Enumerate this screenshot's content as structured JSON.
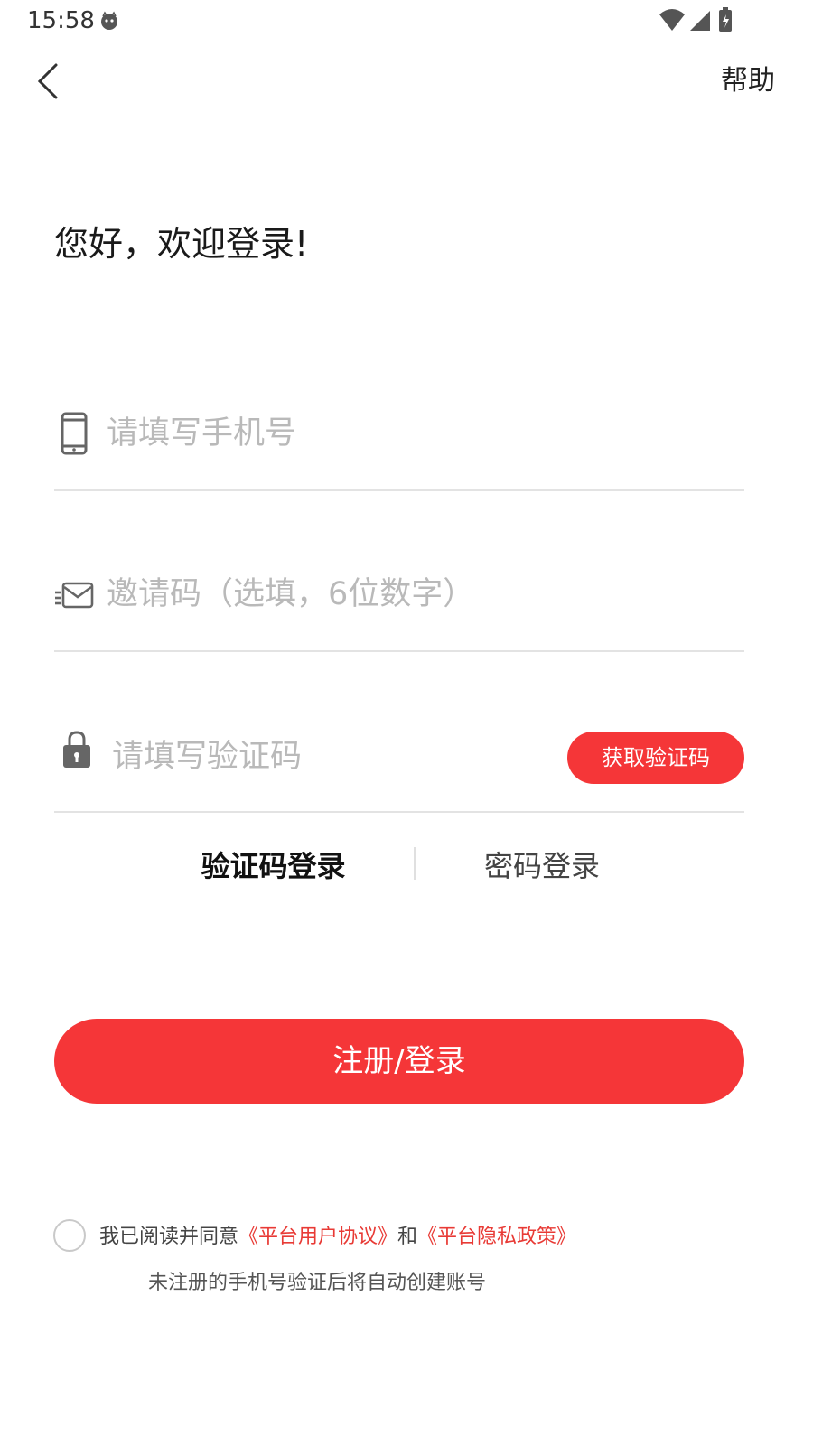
{
  "status_bar": {
    "time": "15:58"
  },
  "nav": {
    "help_label": "帮助"
  },
  "welcome_text": "您好，欢迎登录!",
  "phone_field": {
    "placeholder": "请填写手机号"
  },
  "invite_field": {
    "placeholder": "邀请码（选填，6位数字）"
  },
  "code_field": {
    "placeholder": "请填写验证码",
    "get_code_label": "获取验证码"
  },
  "login_tabs": {
    "active": "验证码登录",
    "other": "密码登录"
  },
  "submit_label": "注册/登录",
  "agreement": {
    "prefix": "我已阅读并同意",
    "user_agreement": "《平台用户协议》",
    "joiner": "和",
    "privacy_policy": "《平台隐私政策》",
    "note": "未注册的手机号验证后将自动创建账号"
  },
  "colors": {
    "accent": "#f53638",
    "link": "#e83a35",
    "placeholder": "#b9b9b9"
  }
}
